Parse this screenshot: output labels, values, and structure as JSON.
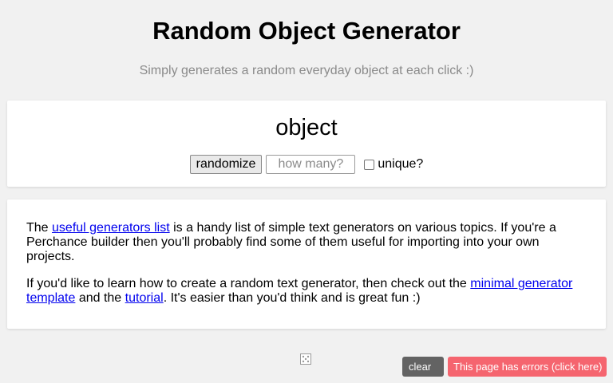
{
  "header": {
    "title": "Random Object Generator",
    "subtitle": "Simply generates a random everyday object at each click :)"
  },
  "generator": {
    "output": "object",
    "randomize_label": "randomize",
    "count_placeholder": "how many?",
    "unique_label": "unique?",
    "unique_checked": false
  },
  "info": {
    "p1_before": "The ",
    "p1_link": "useful generators list",
    "p1_after": " is a handy list of simple text generators on various topics. If you're a Perchance builder then you'll probably find some of them useful for importing into your own projects.",
    "p2_before": "If you'd like to learn how to create a random text generator, then check out the ",
    "p2_link1": "minimal generator template",
    "p2_mid": " and the ",
    "p2_link2": "tutorial",
    "p2_after": ". It's easier than you'd think and is great fun :)"
  },
  "footer": {
    "dice_icon": "dice-icon",
    "clear_glyph": "",
    "clear_label": "clear",
    "errors_label": "This page has errors (click here)"
  },
  "colors": {
    "background": "#f1f1f1",
    "link": "#0000ee",
    "clear_button": "#636363",
    "errors_button": "#f5656f"
  }
}
